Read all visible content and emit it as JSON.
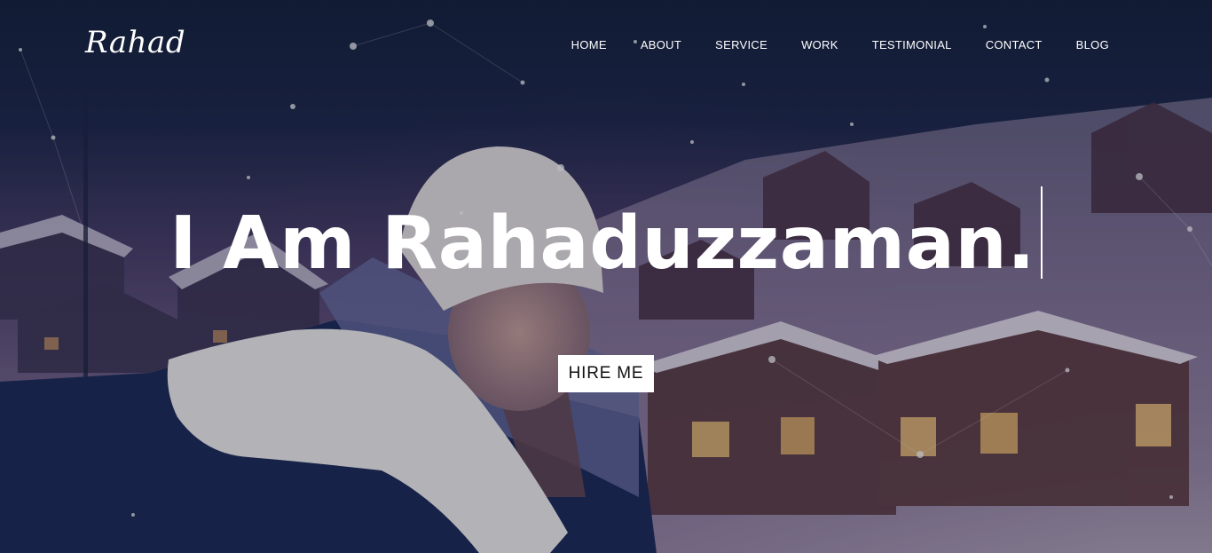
{
  "brand": {
    "logo_text": "Rahad"
  },
  "nav": {
    "items": [
      {
        "label": "HOME"
      },
      {
        "label": "ABOUT"
      },
      {
        "label": "SERVICE"
      },
      {
        "label": "WORK"
      },
      {
        "label": "TESTIMONIAL"
      },
      {
        "label": "CONTACT"
      },
      {
        "label": "BLOG"
      }
    ]
  },
  "hero": {
    "headline": "I Am Rahaduzzaman.",
    "cta_label": "HIRE ME"
  }
}
